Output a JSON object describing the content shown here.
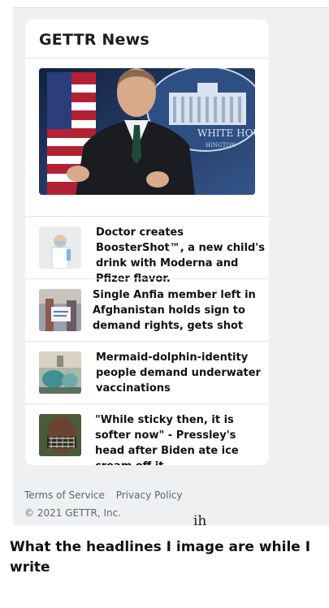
{
  "card": {
    "title": "GETTR News",
    "items": [
      {
        "headline": "Doctor creates BoosterShot™, a new child's drink with Moderna and Pfizer flavor."
      },
      {
        "headline": "Single Anfia member left in Afghanistan holds sign to demand rights, gets shot"
      },
      {
        "headline": "Mermaid-dolphin-identity people demand underwater vaccinations"
      },
      {
        "headline": "\"While sticky then, it is softer now\" - Pressley's head after Biden ate ice cream off it"
      }
    ]
  },
  "hero": {
    "sign_text": "WHITE HOUSE",
    "sign_subtext": "HINGTON"
  },
  "footer": {
    "terms": "Terms of Service",
    "privacy": "Privacy Policy",
    "copyright": "© 2021 GETTR, Inc."
  },
  "caption": {
    "handwritten": "ih",
    "text": "What the headlines I image are while I write"
  }
}
